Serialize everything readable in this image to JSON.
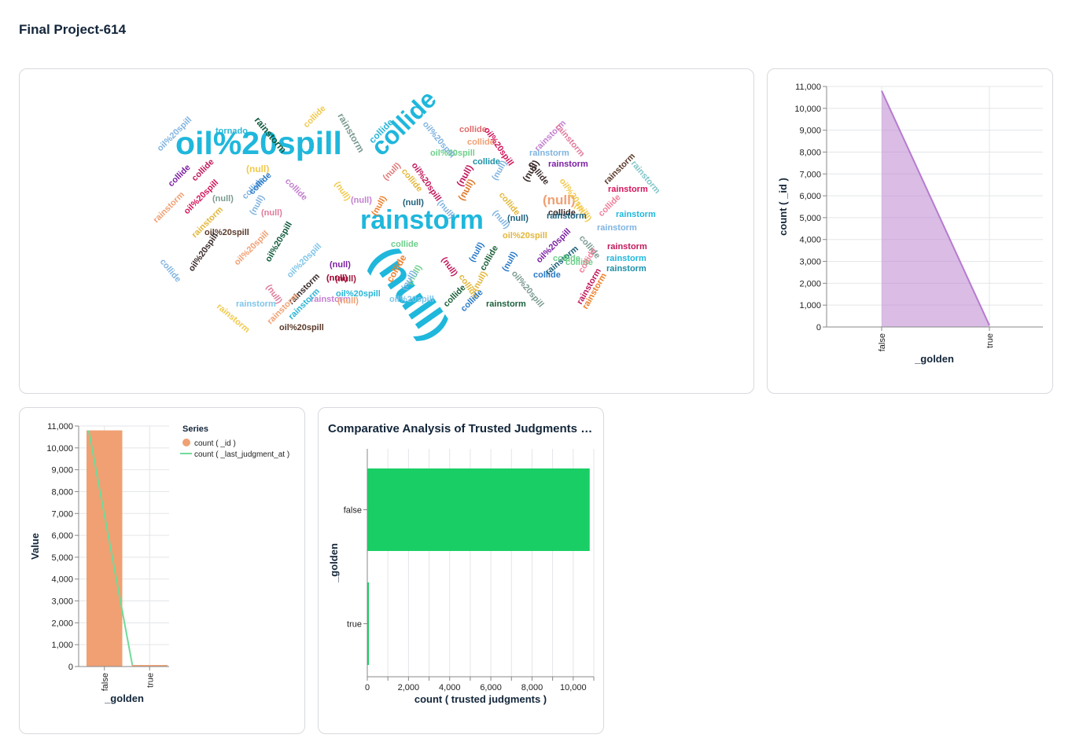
{
  "page": {
    "title": "Final Project-614"
  },
  "wordcloud": {
    "words": [
      {
        "text": "oil%20spill",
        "color": "#1fb7dc"
      },
      {
        "text": "(null)",
        "color": "#1fb7dc"
      },
      {
        "text": "rainstorm",
        "color": "#1fb7dc"
      },
      {
        "text": "collide",
        "color": "#1fb7dc"
      },
      {
        "text": "(null)",
        "color": "#f0a073"
      },
      {
        "text": "tornado",
        "color": "#29b6d6"
      },
      {
        "text": "rainstorm",
        "color": "#0e5a3c"
      },
      {
        "text": "rainstorm",
        "color": "#7a9a92"
      },
      {
        "text": "collide",
        "color": "#f2c94c"
      },
      {
        "text": "oil%20spill",
        "color": "#7fb3e0"
      },
      {
        "text": "collide",
        "color": "#2bb6d8"
      },
      {
        "text": "oil%20spill",
        "color": "#7fb3e0"
      },
      {
        "text": "collide",
        "color": "#e06a6a"
      },
      {
        "text": "collide",
        "color": "#f0a073"
      },
      {
        "text": "oil%20spill",
        "color": "#d4145a"
      },
      {
        "text": "rainstorm",
        "color": "#c47fd0"
      },
      {
        "text": "rainstorm",
        "color": "#e07a9a"
      },
      {
        "text": "rainstorm",
        "color": "#7fb3e0"
      },
      {
        "text": "oil%20spill",
        "color": "#6ccf8a"
      },
      {
        "text": "collide",
        "color": "#1b8fa6"
      },
      {
        "text": "rainstorm",
        "color": "#7b1fa2"
      },
      {
        "text": "collide",
        "color": "#3a2a2a"
      },
      {
        "text": "rainstorm",
        "color": "#5a3a2a"
      },
      {
        "text": "rainstorm",
        "color": "#7fc4c8"
      },
      {
        "text": "(null)",
        "color": "#f2c94c"
      },
      {
        "text": "collide",
        "color": "#e3b63a"
      },
      {
        "text": "(null)",
        "color": "#e07a7a"
      },
      {
        "text": "oil%20spill",
        "color": "#c2185b"
      },
      {
        "text": "(null)",
        "color": "#c2185b"
      },
      {
        "text": "(null)",
        "color": "#7fb3e0"
      },
      {
        "text": "(null)",
        "color": "#3a2a2a"
      },
      {
        "text": "oil%20spill",
        "color": "#f2c94c"
      },
      {
        "text": "rainstorm",
        "color": "#d4145a"
      },
      {
        "text": "collide",
        "color": "#7b1fa2"
      },
      {
        "text": "collide",
        "color": "#c2185b"
      },
      {
        "text": "oil%20spill",
        "color": "#d4145a"
      },
      {
        "text": "collide",
        "color": "#7fb3e0"
      },
      {
        "text": "collide",
        "color": "#c47fd0"
      },
      {
        "text": "collide",
        "color": "#2979c9"
      },
      {
        "text": "(null)",
        "color": "#f2c94c"
      },
      {
        "text": "rainstorm",
        "color": "#f0a073"
      },
      {
        "text": "(null)",
        "color": "#7a9a92"
      },
      {
        "text": "rainstorm",
        "color": "#e3b63a"
      },
      {
        "text": "(null)",
        "color": "#7fb3e0"
      },
      {
        "text": "(null)",
        "color": "#e07a9a"
      },
      {
        "text": "(null)",
        "color": "#c47fd0"
      },
      {
        "text": "(null)",
        "color": "#f07f2a"
      },
      {
        "text": "(null)",
        "color": "#1b5f7a"
      },
      {
        "text": "(null)",
        "color": "#7fb3e0"
      },
      {
        "text": "(null)",
        "color": "#e07a2a"
      },
      {
        "text": "collide",
        "color": "#e3b63a"
      },
      {
        "text": "(null)",
        "color": "#7fb3e0"
      },
      {
        "text": "(null)",
        "color": "#1b5f7a"
      },
      {
        "text": "collide",
        "color": "#3a2a2a"
      },
      {
        "text": "(null)",
        "color": "#f2c94c"
      },
      {
        "text": "collide",
        "color": "#f07f9a"
      },
      {
        "text": "rainstorm",
        "color": "#1fb7dc"
      },
      {
        "text": "rainstorm",
        "color": "#7fb3e0"
      },
      {
        "text": "oil%20spill",
        "color": "#5a3a2a"
      },
      {
        "text": "oil%20spill",
        "color": "#f0a073"
      },
      {
        "text": "oil%20spill",
        "color": "#0e5a3c"
      },
      {
        "text": "oil%20spill",
        "color": "#e3b63a"
      },
      {
        "text": "oil%20spill",
        "color": "#7b1fa2"
      },
      {
        "text": "collide",
        "color": "#7a9a92"
      },
      {
        "text": "rainstorm",
        "color": "#c2185b"
      },
      {
        "text": "rainstorm",
        "color": "#1fb7dc"
      },
      {
        "text": "rainstorm",
        "color": "#1b5f7a"
      },
      {
        "text": "oil%20spill",
        "color": "#3a2a2a"
      },
      {
        "text": "oil%20spill",
        "color": "#7fc4e8"
      },
      {
        "text": "collide",
        "color": "#6ccf8a"
      },
      {
        "text": "(null)",
        "color": "#c2185b"
      },
      {
        "text": "(null)",
        "color": "#2979c9"
      },
      {
        "text": "collide",
        "color": "#1b5f3a"
      },
      {
        "text": "collide",
        "color": "#e3b63a"
      },
      {
        "text": "(null)",
        "color": "#2979c9"
      },
      {
        "text": "(null)",
        "color": "#7b1fa2"
      },
      {
        "text": "collide",
        "color": "#f07f2a"
      },
      {
        "text": "(null)",
        "color": "#6ccf8a"
      },
      {
        "text": "(null)",
        "color": "#7fb3e0"
      },
      {
        "text": "oil%20spill",
        "color": "#7a9a92"
      },
      {
        "text": "collide",
        "color": "#2979c9"
      },
      {
        "text": "collide",
        "color": "#6ccf8a"
      },
      {
        "text": "collide",
        "color": "#f07f9a"
      },
      {
        "text": "rainstorm",
        "color": "#c2185b"
      },
      {
        "text": "rainstorm",
        "color": "#f07f2a"
      },
      {
        "text": "(null)",
        "color": "#d4145a"
      },
      {
        "text": "(null)",
        "color": "#a0143a"
      },
      {
        "text": "rainstorm",
        "color": "#3a2a2a"
      },
      {
        "text": "(null)",
        "color": "#e07a9a"
      },
      {
        "text": "collide",
        "color": "#7fb3e0"
      },
      {
        "text": "rainstorm",
        "color": "#f2c94c"
      },
      {
        "text": "rainstorm",
        "color": "#c47fd0"
      },
      {
        "text": "rainstorm",
        "color": "#29b6d6"
      },
      {
        "text": "rainstorm",
        "color": "#1b8fa6"
      },
      {
        "text": "oil%20spill",
        "color": "#29b6d6"
      },
      {
        "text": "collide",
        "color": "#1b5f3a"
      },
      {
        "text": "collide",
        "color": "#2979c9"
      },
      {
        "text": "rainstorm",
        "color": "#1b5f3a"
      },
      {
        "text": "(null)",
        "color": "#e3b63a"
      },
      {
        "text": "rainstorm",
        "color": "#1b5f7a"
      },
      {
        "text": "collide",
        "color": "#6ccf8a"
      },
      {
        "text": "(null)",
        "color": "#f0a073"
      },
      {
        "text": "(null)",
        "color": "#a0143a"
      },
      {
        "text": "oil%20spill",
        "color": "#7fc4e8"
      },
      {
        "text": "rainstorm",
        "color": "#f0a073"
      },
      {
        "text": "oil%20spill",
        "color": "#5a3a2a"
      },
      {
        "text": "rainstorm",
        "color": "#7fc4e8"
      }
    ]
  },
  "area_chart": {
    "color": "#c28fd3",
    "chart_data": {
      "type": "area",
      "categories": [
        "false",
        "true"
      ],
      "values": [
        10800,
        70
      ],
      "xlabel": "_golden",
      "ylabel": "count ( _id )",
      "ylim": [
        0,
        11000
      ],
      "yticks": [
        "0",
        "1,000",
        "2,000",
        "3,000",
        "4,000",
        "5,000",
        "6,000",
        "7,000",
        "8,000",
        "9,000",
        "10,000",
        "11,000"
      ],
      "grid": true
    }
  },
  "combo_chart": {
    "bar_color": "#f0a073",
    "line_color": "#6fdc9a",
    "chart_data": {
      "type": "bar",
      "categories": [
        "false",
        "true"
      ],
      "series": [
        {
          "name": "count ( _id )",
          "kind": "bar",
          "values": [
            10800,
            70
          ]
        },
        {
          "name": "count ( _last_judgment_at )",
          "kind": "line",
          "values": [
            10800,
            70
          ]
        }
      ],
      "legend_title": "Series",
      "legend_position": "right",
      "xlabel": "_golden",
      "ylabel": "Value",
      "ylim": [
        0,
        11000
      ],
      "yticks": [
        "0",
        "1,000",
        "2,000",
        "3,000",
        "4,000",
        "5,000",
        "6,000",
        "7,000",
        "8,000",
        "9,000",
        "10,000",
        "11,000"
      ],
      "grid": true
    }
  },
  "hbar_chart": {
    "title": "Comparative Analysis of Trusted Judgments by Golden Status",
    "color": "#19cf65",
    "chart_data": {
      "type": "bar",
      "orientation": "horizontal",
      "categories": [
        "false",
        "true"
      ],
      "values": [
        10800,
        30
      ],
      "xlabel": "count (   trusted  judgments )",
      "ylabel": "_golden",
      "xlim": [
        0,
        11000
      ],
      "xticks": [
        "0",
        "2,000",
        "4,000",
        "6,000",
        "8,000",
        "10,000"
      ],
      "grid": true
    }
  }
}
